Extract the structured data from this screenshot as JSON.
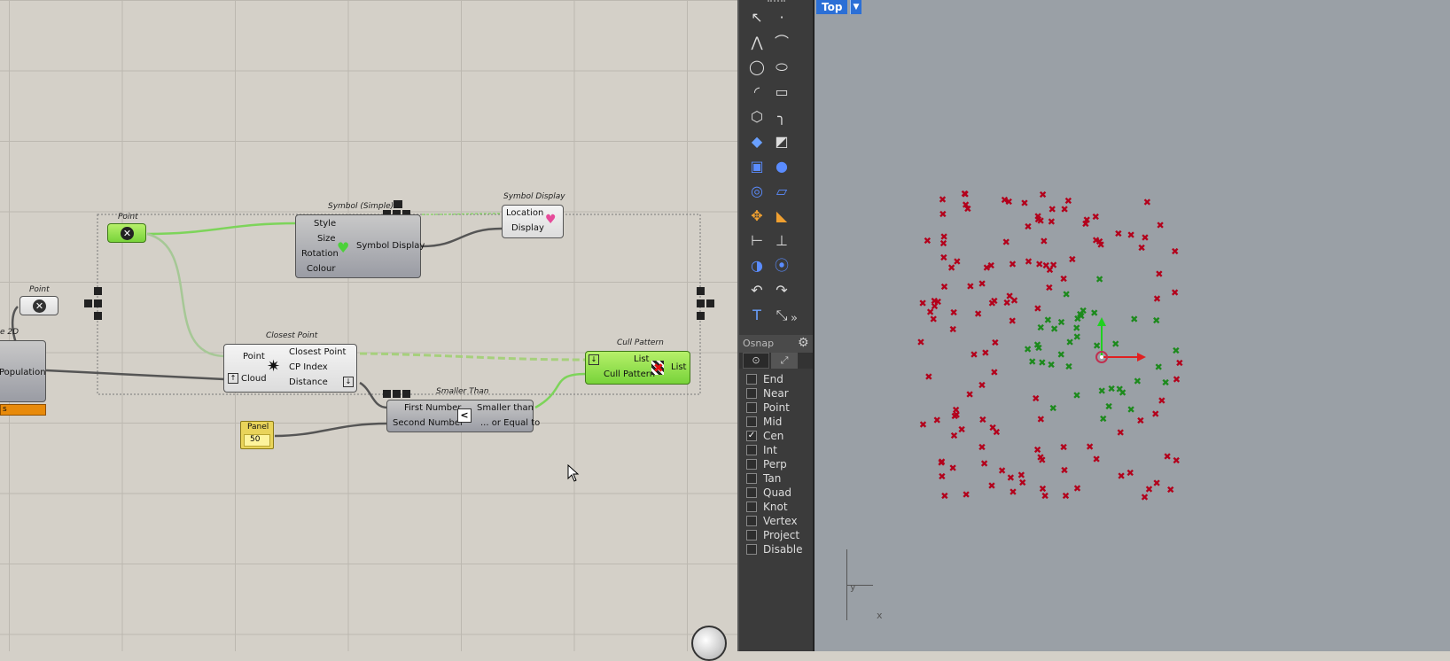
{
  "canvas": {
    "point_param": {
      "label": "Point"
    },
    "point_param2": {
      "label": "Point"
    },
    "population": {
      "label": "Population",
      "caption": "e 2D",
      "footer": "s"
    },
    "symbol_simple": {
      "caption": "Symbol (Simple)",
      "inputs": [
        "Style",
        "Size",
        "Rotation",
        "Colour"
      ],
      "output": "Symbol Display"
    },
    "symbol_display": {
      "caption": "Symbol Display",
      "inputs": [
        "Location",
        "Display"
      ]
    },
    "closest_point": {
      "caption": "Closest Point",
      "inputs": [
        "Point",
        "Cloud"
      ],
      "outputs": [
        "Closest Point",
        "CP Index",
        "Distance"
      ]
    },
    "cull_pattern": {
      "caption": "Cull Pattern",
      "inputs": [
        "List",
        "Cull Pattern"
      ],
      "output": "List"
    },
    "smaller_than": {
      "caption": "Smaller Than",
      "inputs": [
        "First Number",
        "Second Number"
      ],
      "outputs": [
        "Smaller than",
        "... or Equal to"
      ],
      "symbol": "<"
    },
    "panel": {
      "label": "Panel",
      "value": "50"
    }
  },
  "toolbar": {
    "osnap_title": "Osnap",
    "osnap_items": [
      {
        "label": "End",
        "checked": false
      },
      {
        "label": "Near",
        "checked": false
      },
      {
        "label": "Point",
        "checked": false
      },
      {
        "label": "Mid",
        "checked": false
      },
      {
        "label": "Cen",
        "checked": true
      },
      {
        "label": "Int",
        "checked": false
      },
      {
        "label": "Perp",
        "checked": false
      },
      {
        "label": "Tan",
        "checked": false
      },
      {
        "label": "Quad",
        "checked": false
      },
      {
        "label": "Knot",
        "checked": false
      },
      {
        "label": "Vertex",
        "checked": false
      },
      {
        "label": "Project",
        "checked": false
      },
      {
        "label": "Disable",
        "checked": false
      }
    ],
    "icons": [
      "select-arrow-icon",
      "point-icon",
      "polyline-icon",
      "curve-icon",
      "circle-icon",
      "ellipse-icon",
      "arc-icon",
      "rectangle-icon",
      "polygon-icon",
      "fillet-icon",
      "surface-icon",
      "extrude-icon",
      "box-icon",
      "sphere-icon",
      "cylinder-icon",
      "plane-icon",
      "transform-icon",
      "explode-icon",
      "dimension-icon",
      "align-icon",
      "boolean-icon",
      "group-icon",
      "curve-tools-icon",
      "offset-icon",
      "text-icon",
      "scale-icon"
    ]
  },
  "viewport": {
    "name": "Top",
    "axis_x": "x",
    "axis_y": "y",
    "colors": {
      "red": "#b3001b",
      "green": "#1c8a1c",
      "bg": "#9aa0a6"
    }
  }
}
